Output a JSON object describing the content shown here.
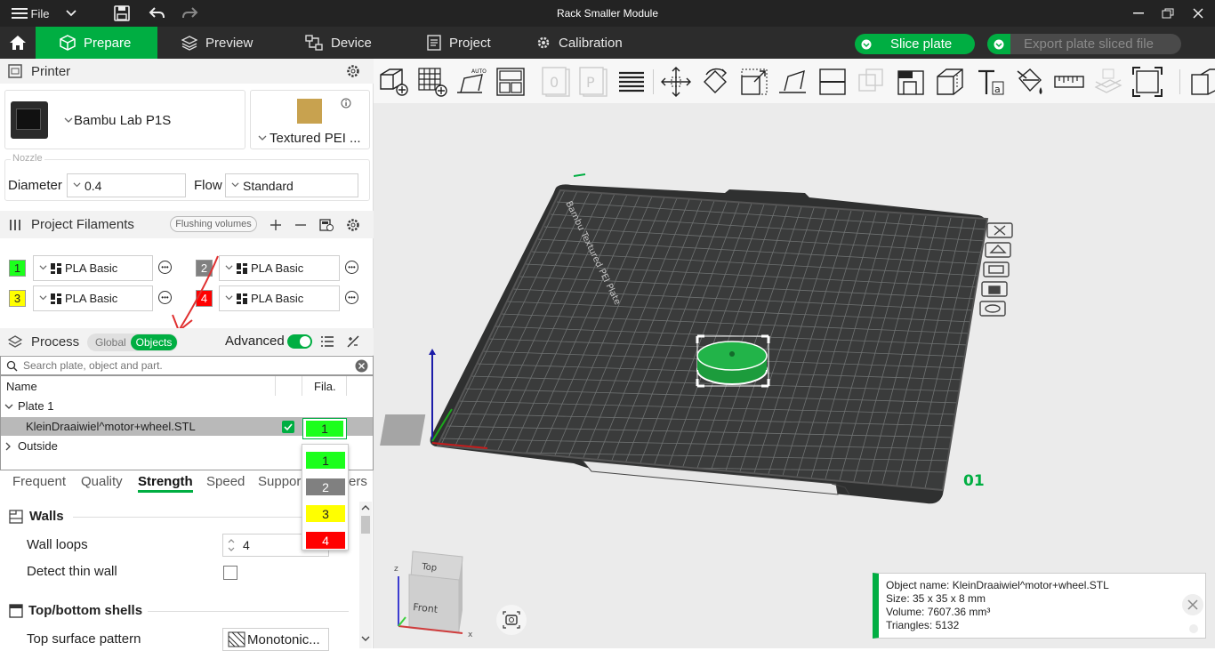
{
  "window": {
    "title": "Rack Smaller Module",
    "file_menu": "File"
  },
  "nav": {
    "tabs": [
      {
        "label": "Prepare"
      },
      {
        "label": "Preview"
      },
      {
        "label": "Device"
      },
      {
        "label": "Project"
      },
      {
        "label": "Calibration"
      }
    ],
    "slice_button": "Slice plate",
    "export_button": "Export plate sliced file"
  },
  "printer": {
    "section_title": "Printer",
    "model": "Bambu Lab P1S",
    "plate": "Textured PEI ...",
    "nozzle_label": "Nozzle",
    "diameter_label": "Diameter",
    "diameter_value": "0.4",
    "flow_label": "Flow",
    "flow_value": "Standard"
  },
  "filaments": {
    "section_title": "Project Filaments",
    "flushing_label": "Flushing volumes",
    "items": [
      {
        "num": "1",
        "name": "PLA Basic",
        "color": "#1cff1c"
      },
      {
        "num": "2",
        "name": "PLA Basic",
        "color": "#808080"
      },
      {
        "num": "3",
        "name": "PLA Basic",
        "color": "#ffff00"
      },
      {
        "num": "4",
        "name": "PLA Basic",
        "color": "#ff0000"
      }
    ]
  },
  "process": {
    "section_title": "Process",
    "toggle_global": "Global",
    "toggle_objects": "Objects",
    "advanced_label": "Advanced",
    "search_placeholder": "Search plate, object and part."
  },
  "objects": {
    "col_name": "Name",
    "col_fila": "Fila.",
    "plate": "Plate 1",
    "object": "KleinDraaiwiel^motor+wheel.STL",
    "object_fila": "1",
    "outside": "Outside"
  },
  "settings_tabs": [
    "Frequent",
    "Quality",
    "Strength",
    "Speed",
    "Suppor",
    "ers"
  ],
  "walls": {
    "title": "Walls",
    "wall_loops_label": "Wall loops",
    "wall_loops_value": "4",
    "detect_thin_label": "Detect thin wall"
  },
  "shells": {
    "title": "Top/bottom shells",
    "top_pattern_label": "Top surface pattern",
    "top_pattern_value": "Monotonic..."
  },
  "dropdown": {
    "options": [
      {
        "num": "1",
        "color": "#1cff1c"
      },
      {
        "num": "2",
        "color": "#808080"
      },
      {
        "num": "3",
        "color": "#ffff00"
      },
      {
        "num": "4",
        "color": "#ff0000"
      }
    ]
  },
  "viewport": {
    "plate_number": "01",
    "plate_text": "Bambu Textured PEI Plate",
    "cube_top": "Top",
    "cube_front": "Front",
    "axis_x": "x",
    "axis_z": "z"
  },
  "info": {
    "object_name": "Object name: KleinDraaiwiel^motor+wheel.STL",
    "size": "Size: 35 x 35 x 8 mm",
    "volume": "Volume: 7607.36 mm³",
    "triangles": "Triangles: 5132"
  },
  "colors": {
    "accent": "#00ae42",
    "topbar": "#232323",
    "navbar": "#2c2c2c"
  }
}
